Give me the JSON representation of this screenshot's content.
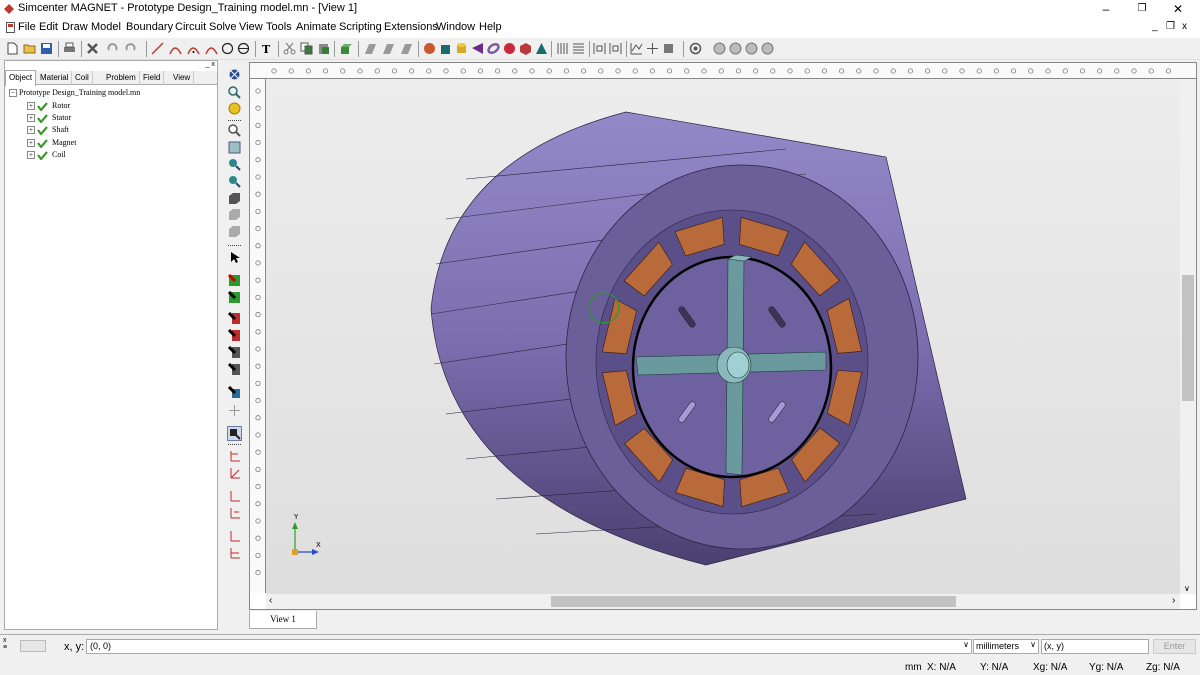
{
  "window": {
    "title": "Simcenter MAGNET - Prototype Design_Training model.mn - [View 1]",
    "minimize": "–",
    "restore": "❐",
    "close": "✕",
    "mdi_minimize": "_",
    "mdi_restore": "❐",
    "mdi_close": "x"
  },
  "menu": {
    "file": "File",
    "edit": "Edit",
    "draw": "Draw",
    "model": "Model",
    "boundary": "Boundary",
    "circuit": "Circuit",
    "solve": "Solve",
    "view": "View",
    "tools": "Tools",
    "animate": "Animate",
    "scripting": "Scripting",
    "extensions": "Extensions",
    "window": "Window",
    "help": "Help"
  },
  "panel": {
    "tabs": [
      "Object",
      "Material",
      "Coil",
      "Problem",
      "Field",
      "View"
    ],
    "active_tab": "Object",
    "tree_root": "Prototype Design_Training model.mn",
    "tree_items": [
      "Rotor",
      "Stator",
      "Shaft",
      "Magnet",
      "Coil"
    ]
  },
  "view": {
    "tab_label": "View 1",
    "axis_x": "X",
    "axis_y": "Y",
    "colors": {
      "housing": "#7b6fb0",
      "housing_face": "#6b5f9a",
      "coil": "#b86a3a",
      "shaft_arms": "#6a9a9e",
      "canvas": "#e6e6e6"
    }
  },
  "command_bar": {
    "coord_label": "x, y:",
    "coord_value": "(0, 0)",
    "units_value": "millimeters",
    "format_value": "(x, y)",
    "enter_label": "Enter"
  },
  "status": {
    "units": "mm",
    "x": "X: N/A",
    "y": "Y: N/A",
    "xg": "Xg: N/A",
    "yg": "Yg: N/A",
    "zg": "Zg: N/A"
  }
}
